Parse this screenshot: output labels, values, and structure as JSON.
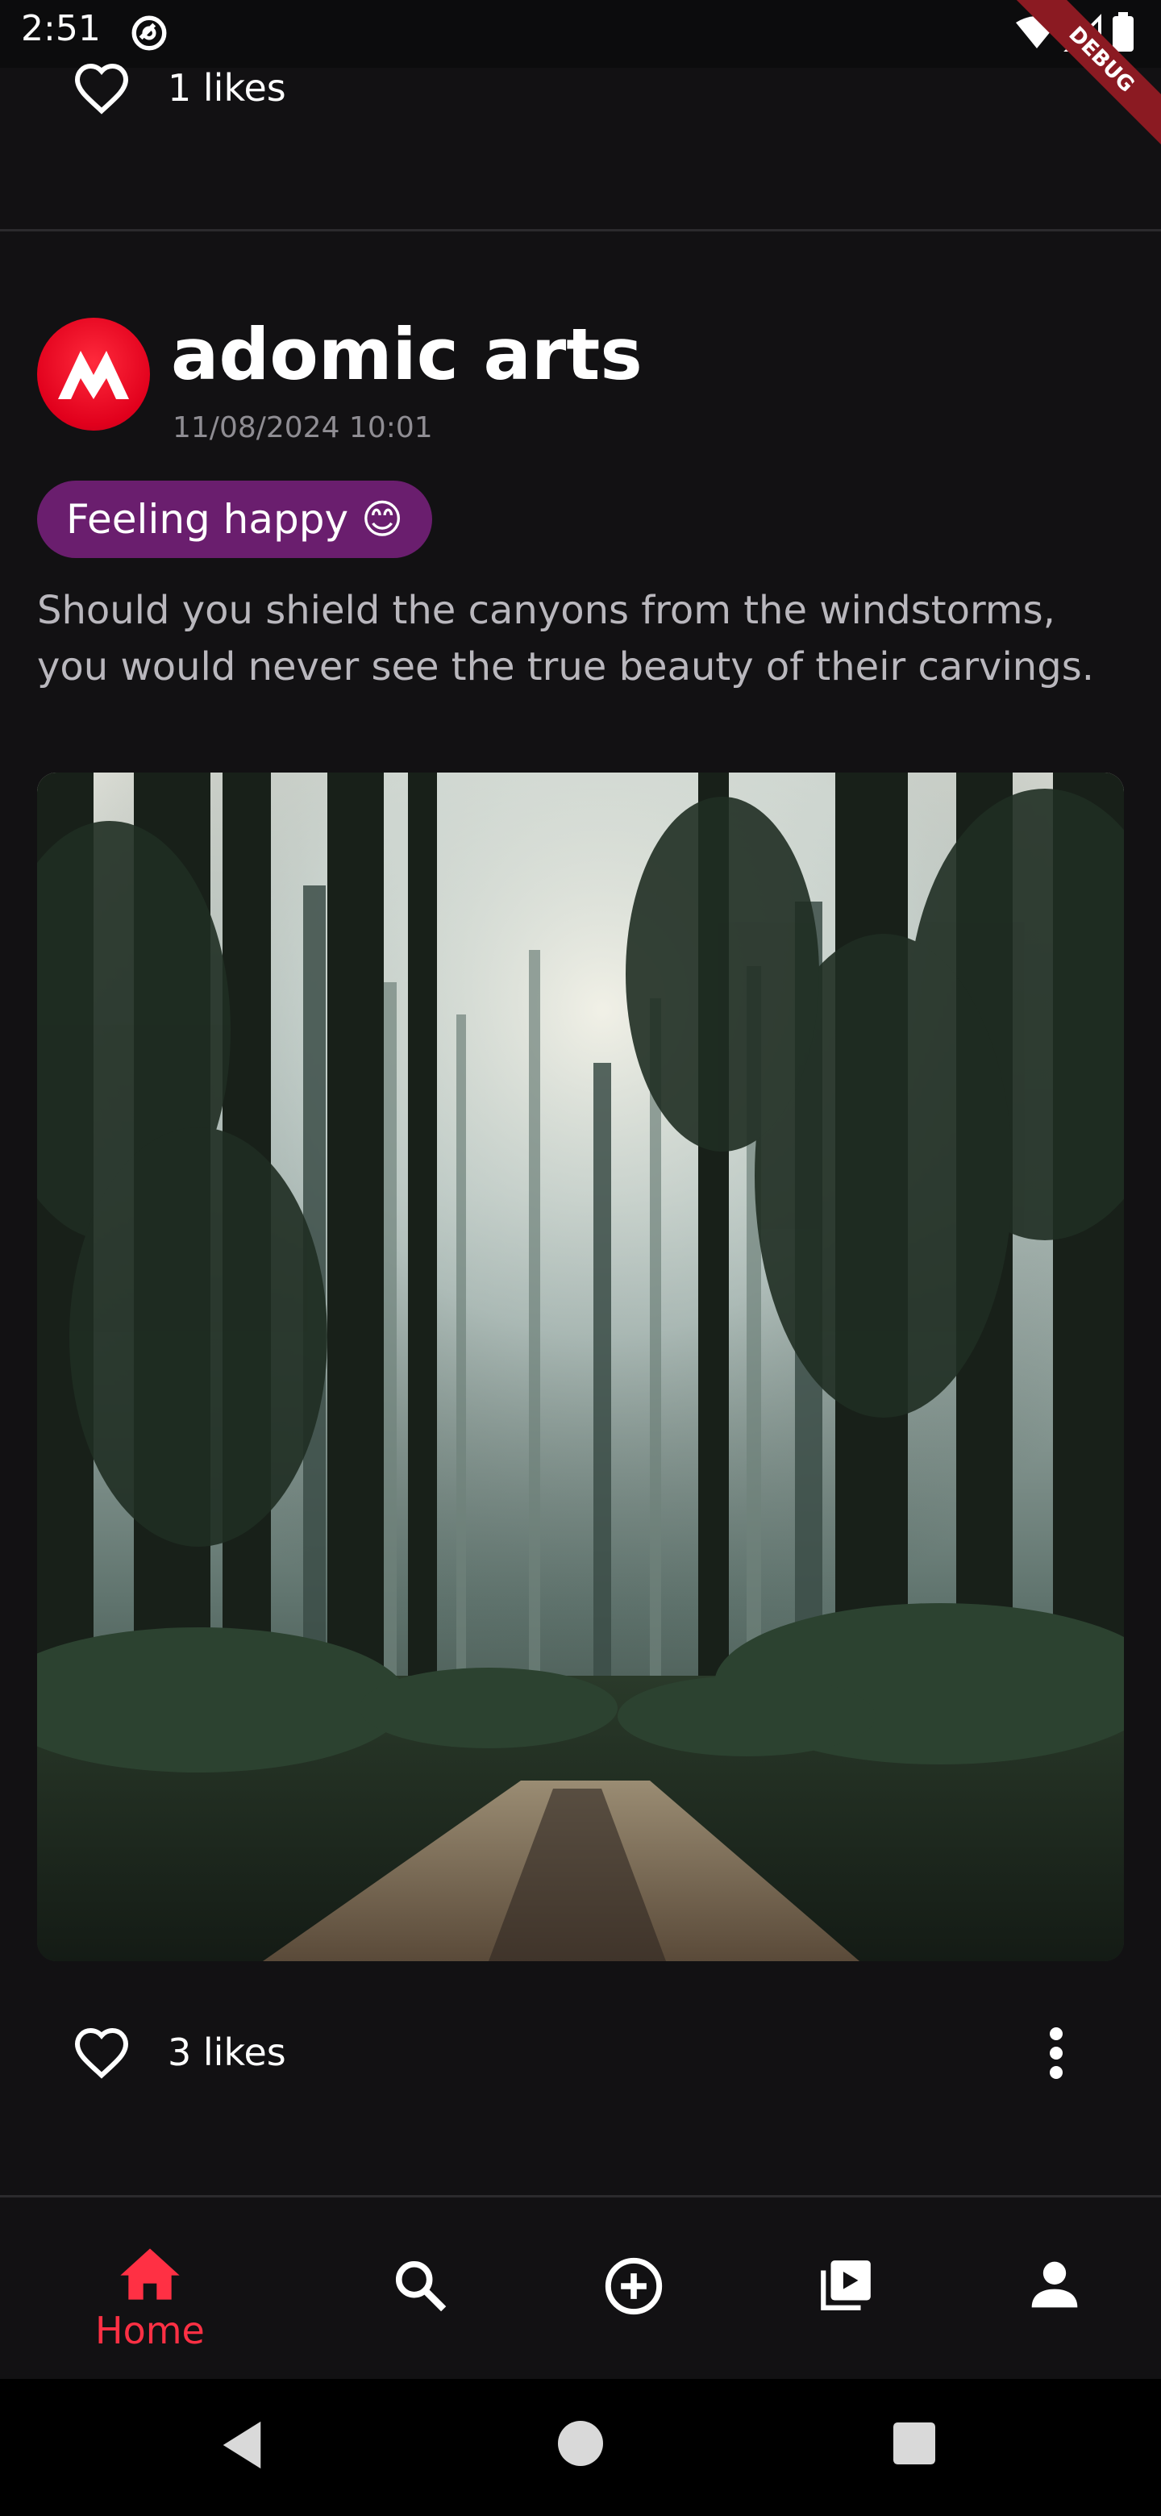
{
  "status_bar": {
    "time": "2:51",
    "debug_label": "DEBUG"
  },
  "previous_post": {
    "likes_label": "1 likes"
  },
  "post": {
    "username": "adomic arts",
    "timestamp": "11/08/2024 10:01",
    "mood": "Feeling happy 😊",
    "caption": "Should you shield the canyons from the windstorms, you would never see the true beauty of their carvings.",
    "likes_label": "3 likes"
  },
  "bottom_nav": {
    "items": [
      {
        "label": "Home",
        "icon": "home-icon",
        "active": true
      },
      {
        "label": "",
        "icon": "search-icon",
        "active": false
      },
      {
        "label": "",
        "icon": "add-circle-icon",
        "active": false
      },
      {
        "label": "",
        "icon": "video-library-icon",
        "active": false
      },
      {
        "label": "",
        "icon": "person-icon",
        "active": false
      }
    ]
  },
  "colors": {
    "background": "#121113",
    "accent": "#ff3044",
    "mood_pill": "#6a1e6e",
    "avatar": "#e1001c"
  }
}
